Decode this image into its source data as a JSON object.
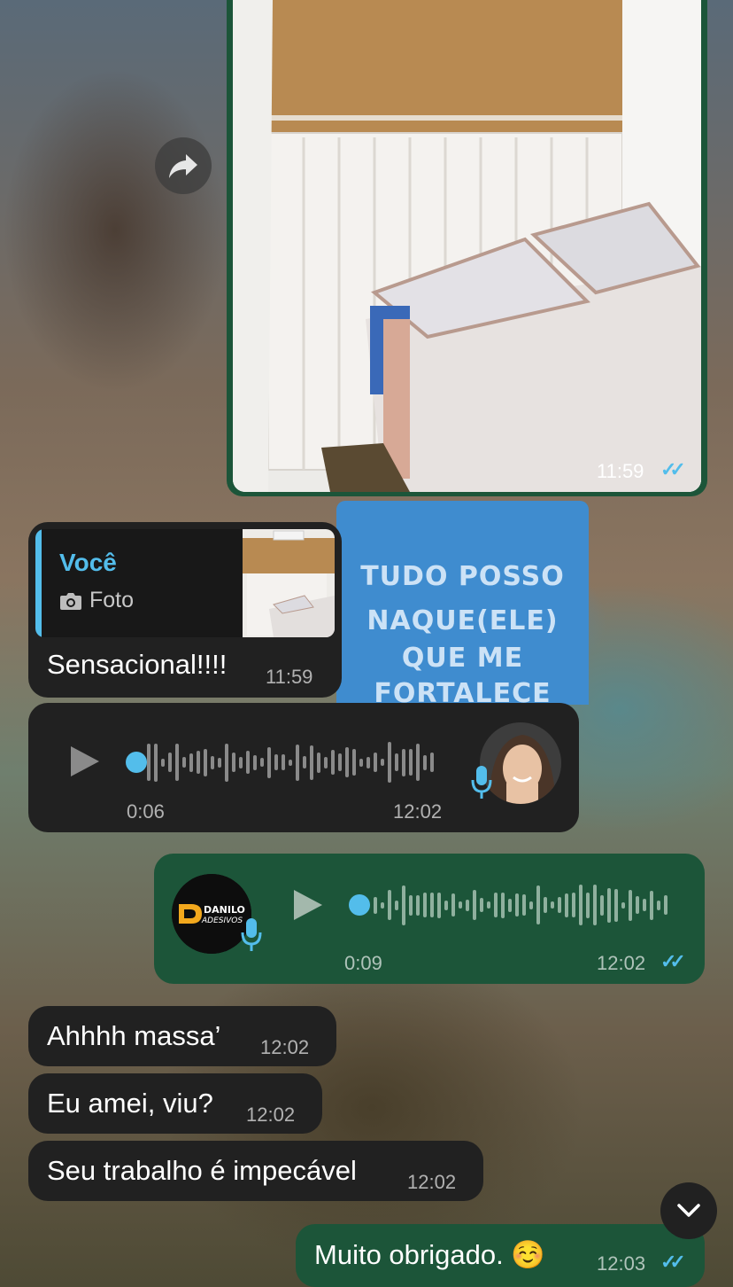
{
  "wallpaper": {
    "shirt_lines": [
      "TUDO POSSO",
      "NAQUE(ELE)",
      "QUE ME",
      "FORTALECE"
    ]
  },
  "photo_message": {
    "time": "11:59",
    "status": "read"
  },
  "reply_message": {
    "quote_author": "Você",
    "quote_type": "Foto",
    "quote_icon": "camera-icon",
    "text": "Sensacional!!!!",
    "time": "11:59"
  },
  "voice_in": {
    "duration": "0:06",
    "time": "12:02",
    "progress": 0,
    "icons": [
      "play-icon",
      "microphone-icon"
    ]
  },
  "voice_out": {
    "duration": "0:09",
    "time": "12:02",
    "progress": 0,
    "status": "read",
    "avatar_logo": "DANILO ADESIVOS"
  },
  "messages": [
    {
      "text": "Ahhhh massa’",
      "time": "12:02"
    },
    {
      "text": "Eu amei, viu?",
      "time": "12:02"
    },
    {
      "text": "Seu trabalho é impecável",
      "time": "12:02"
    }
  ],
  "last_out": {
    "text": "Muito obrigado. ☺️",
    "time": "12:03",
    "status": "read"
  },
  "colors": {
    "incoming_bubble": "#212121",
    "outgoing_bubble": "#1c5539",
    "accent_blue": "#53bdeb"
  },
  "icons": {
    "forward": "forward-icon",
    "scroll_down": "chevron-down-icon",
    "read_receipt": "double-check-icon"
  }
}
